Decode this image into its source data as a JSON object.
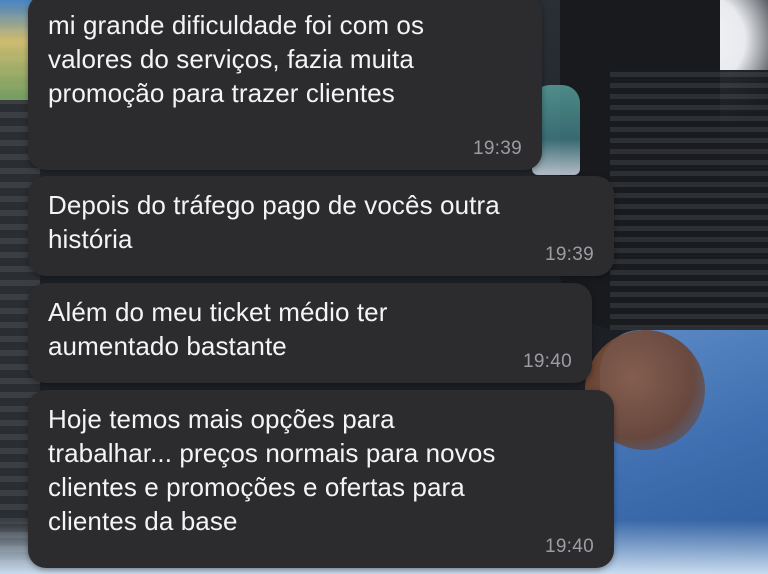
{
  "chat": {
    "messages": [
      {
        "text": "mi grande dificuldade foi com os\nvalores do serviços, fazia muita\npromoção para trazer clientes",
        "time": "19:39"
      },
      {
        "text": "Depois do tráfego pago de vocês outra\nhistória",
        "time": "19:39"
      },
      {
        "text": "Além do meu ticket médio ter\naumentado bastante",
        "time": "19:40"
      },
      {
        "text": "Hoje temos mais opções para\ntrabalhar... preços normais para novos\nclientes e promoções e ofertas para\nclientes da base",
        "time": "19:40"
      }
    ]
  },
  "colors": {
    "bubble_background": "#2c2c2e",
    "bubble_text": "#f4f4f5",
    "timestamp": "#9c9ca3"
  }
}
